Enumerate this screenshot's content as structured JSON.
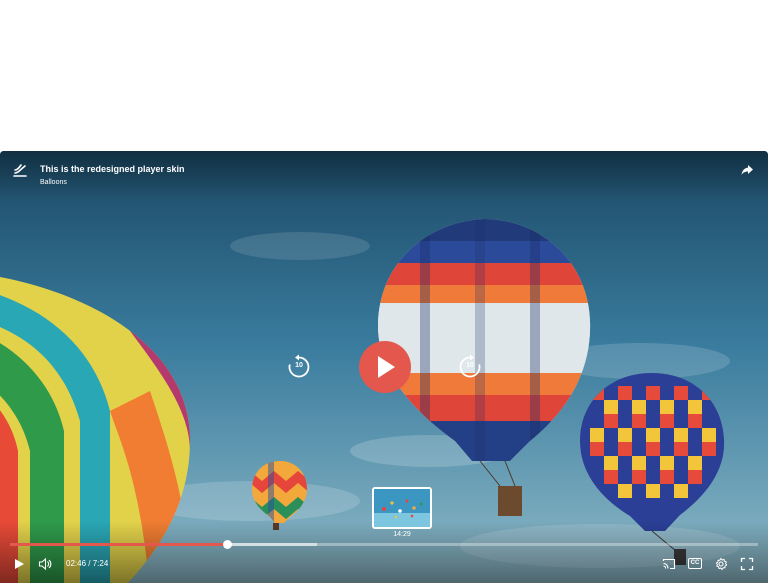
{
  "player": {
    "title": "This is the redesigned player skin",
    "subtitle": "Balloons",
    "current_time": "02:46",
    "duration": "7:24",
    "separator": " / ",
    "preview_time": "14:29",
    "skip_back_seconds": "10",
    "skip_forward_seconds": "10",
    "played_fraction": 0.29,
    "buffered_fraction": 0.41,
    "accent_color": "#e4574c"
  },
  "icons": {
    "logo": "wave-logo-icon",
    "share": "share-icon",
    "play": "play-icon",
    "volume": "volume-icon",
    "cast": "cast-icon",
    "captions": "cc-icon",
    "settings": "gear-icon",
    "fullscreen": "fullscreen-icon"
  },
  "controls": {
    "captions_label": "CC"
  }
}
